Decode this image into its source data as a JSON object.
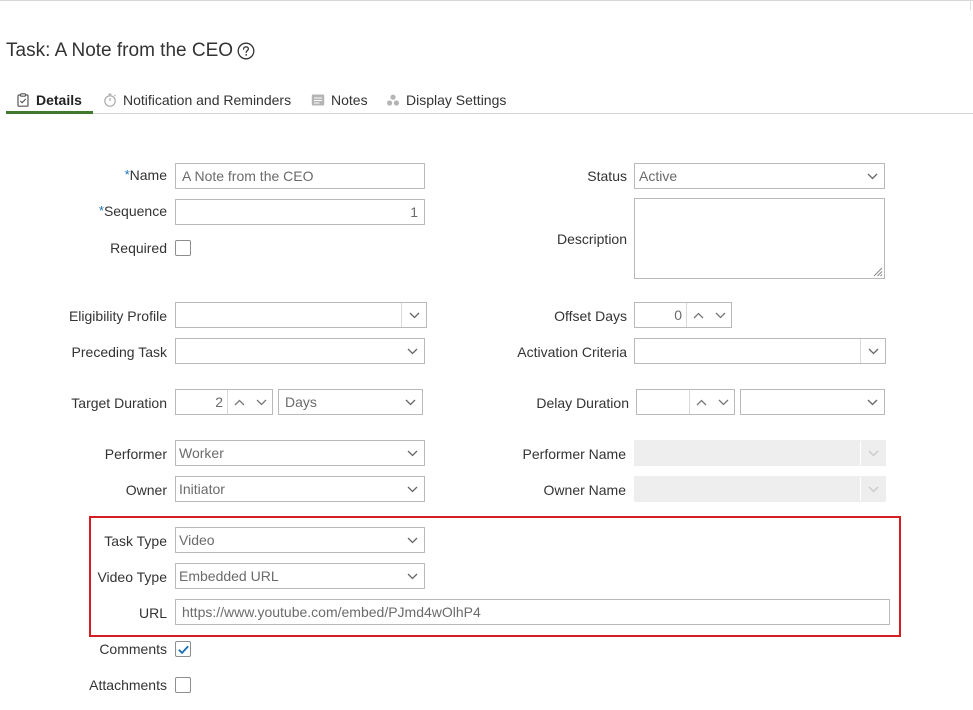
{
  "page": {
    "title": "Task: A Note from the CEO",
    "help_icon": "question-circle-icon"
  },
  "tabs": [
    {
      "label": "Details",
      "icon": "clipboard-icon",
      "active": true
    },
    {
      "label": "Notification and Reminders",
      "icon": "stopwatch-icon",
      "active": false
    },
    {
      "label": "Notes",
      "icon": "note-icon",
      "active": false
    },
    {
      "label": "Display Settings",
      "icon": "dots-cluster-icon",
      "active": false
    }
  ],
  "form": {
    "name": {
      "label": "Name",
      "required_mark": "*",
      "value": "A Note from the CEO"
    },
    "sequence": {
      "label": "Sequence",
      "required_mark": "*",
      "value": "1"
    },
    "required": {
      "label": "Required",
      "checked": false
    },
    "eligibility_profile": {
      "label": "Eligibility Profile",
      "value": ""
    },
    "preceding_task": {
      "label": "Preceding Task",
      "value": ""
    },
    "target_duration": {
      "label": "Target Duration",
      "value": "2",
      "unit": "Days"
    },
    "performer": {
      "label": "Performer",
      "value": "Worker"
    },
    "owner": {
      "label": "Owner",
      "value": "Initiator"
    },
    "task_type": {
      "label": "Task Type",
      "value": "Video"
    },
    "video_type": {
      "label": "Video Type",
      "value": "Embedded URL"
    },
    "url": {
      "label": "URL",
      "value": "https://www.youtube.com/embed/PJmd4wOlhP4"
    },
    "comments": {
      "label": "Comments",
      "checked": true
    },
    "attachments": {
      "label": "Attachments",
      "checked": false
    },
    "status": {
      "label": "Status",
      "value": "Active"
    },
    "description": {
      "label": "Description",
      "value": ""
    },
    "offset_days": {
      "label": "Offset Days",
      "value": "0"
    },
    "activation_criteria": {
      "label": "Activation Criteria",
      "value": ""
    },
    "delay_duration": {
      "label": "Delay Duration",
      "value": "",
      "unit": ""
    },
    "performer_name": {
      "label": "Performer Name",
      "value": ""
    },
    "owner_name": {
      "label": "Owner Name",
      "value": ""
    }
  },
  "colors": {
    "required_mark": "#1a73b8",
    "tab_underline": "#3f7a2e",
    "highlight_border": "#d71d24",
    "checkbox_check": "#1a6fb5"
  }
}
